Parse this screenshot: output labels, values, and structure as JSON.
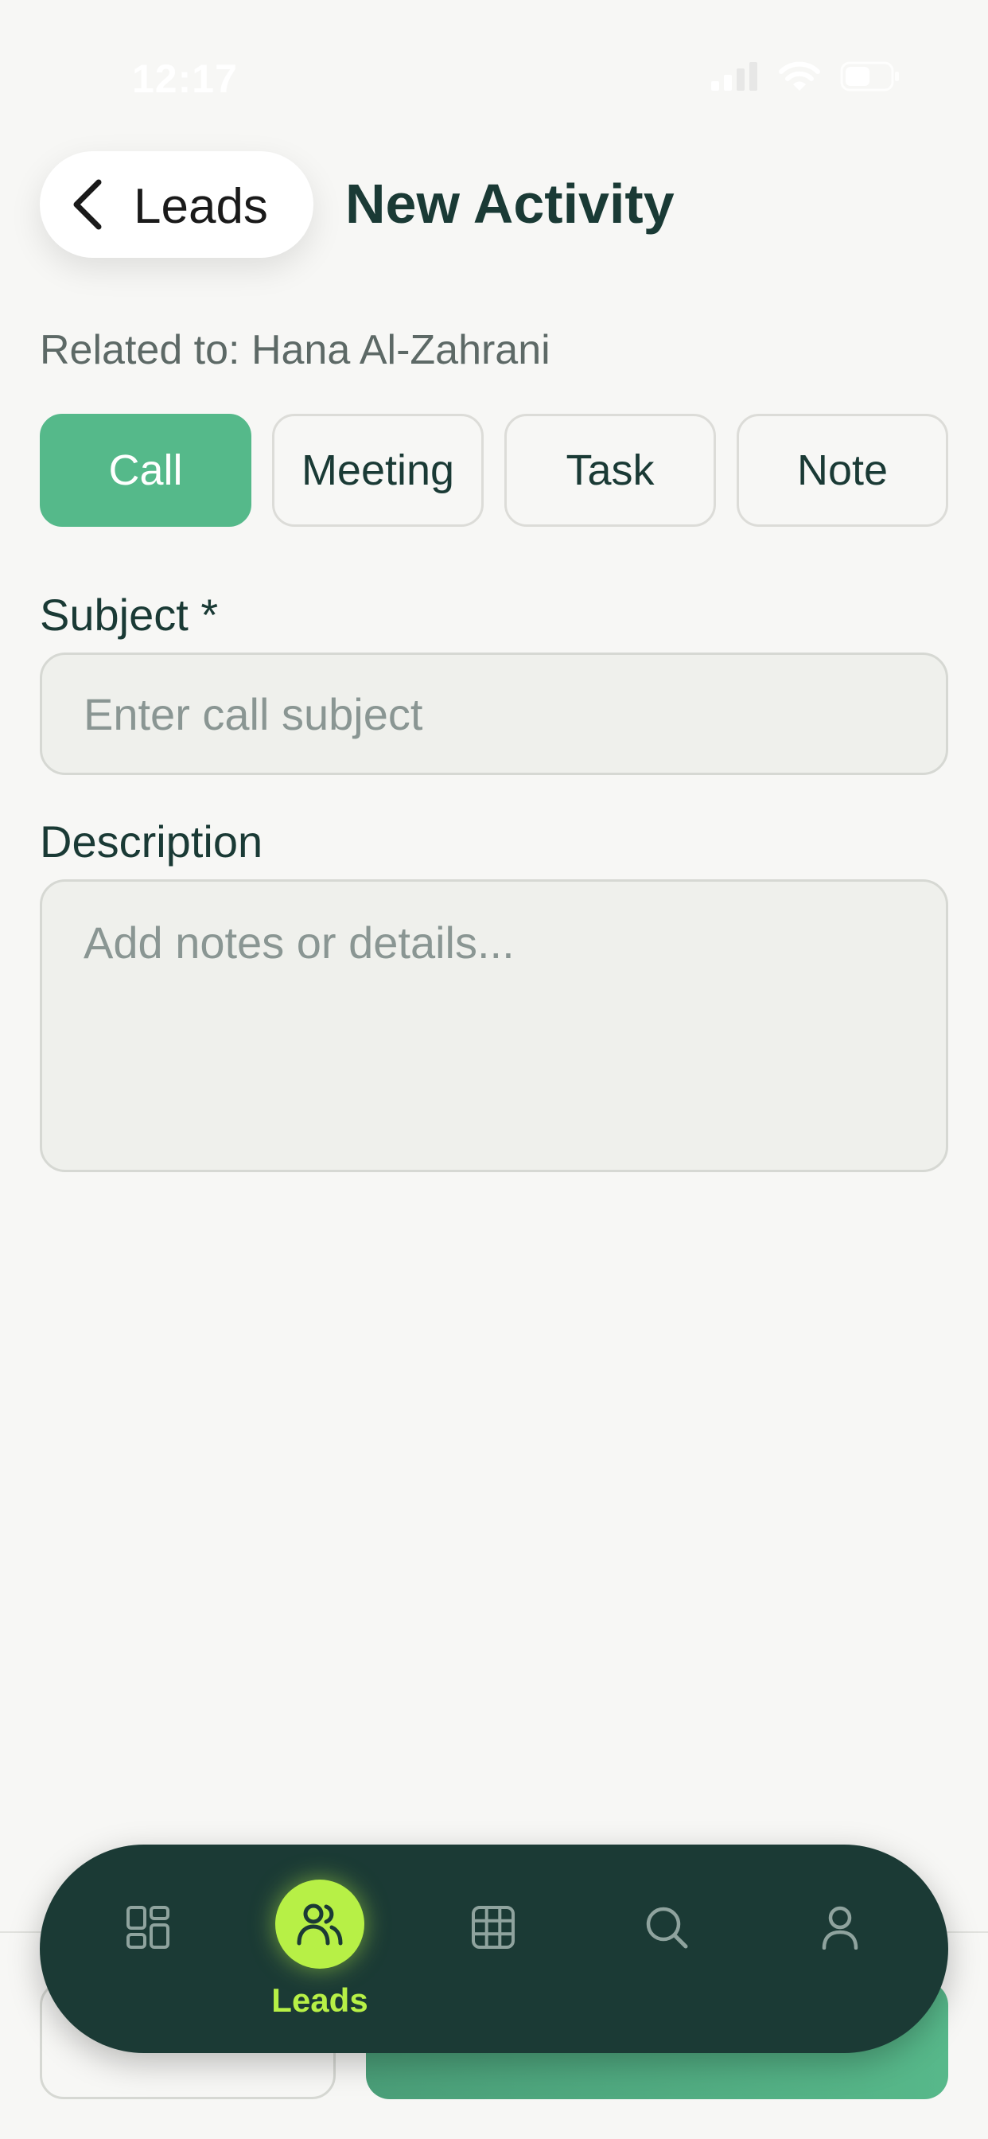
{
  "status_bar": {
    "time": "12:17"
  },
  "header": {
    "back_label": "Leads",
    "title": "New Activity"
  },
  "related_to": "Related to: Hana Al-Zahrani",
  "activity_types": [
    {
      "label": "Call",
      "active": true
    },
    {
      "label": "Meeting",
      "active": false
    },
    {
      "label": "Task",
      "active": false
    },
    {
      "label": "Note",
      "active": false
    }
  ],
  "form": {
    "subject_label": "Subject *",
    "subject_placeholder": "Enter call subject",
    "subject_value": "",
    "description_label": "Description",
    "description_placeholder": "Add notes or details...",
    "description_value": ""
  },
  "tabbar": {
    "items": [
      {
        "icon": "dashboard-icon",
        "label": ""
      },
      {
        "icon": "users-icon",
        "label": "Leads",
        "active": true
      },
      {
        "icon": "grid-icon",
        "label": ""
      },
      {
        "icon": "search-icon",
        "label": ""
      },
      {
        "icon": "user-icon",
        "label": ""
      }
    ]
  },
  "colors": {
    "accent": "#55b98a",
    "tabbar_bg": "#1b3a35",
    "tab_active": "#b7f046",
    "text_dark": "#1a3a35",
    "background": "#f7f7f5"
  }
}
